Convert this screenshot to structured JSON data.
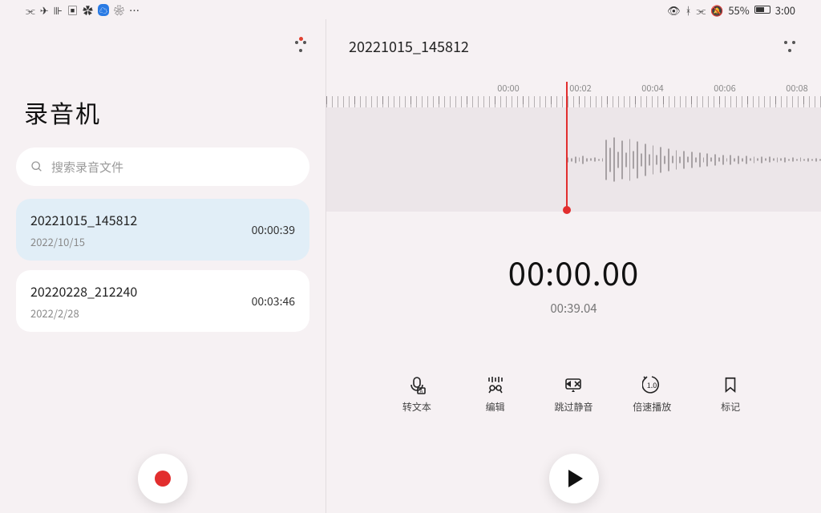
{
  "status": {
    "left_icons": [
      "wifi",
      "airplane",
      "sound",
      "video",
      "tv",
      "cloud",
      "wechat",
      "more"
    ],
    "battery_pct": "55%",
    "time": "3:00"
  },
  "app_title": "录音机",
  "search": {
    "placeholder": "搜索录音文件"
  },
  "recordings": [
    {
      "name": "20221015_145812",
      "date": "2022/10/15",
      "duration": "00:00:39",
      "selected": true
    },
    {
      "name": "20220228_212240",
      "date": "2022/2/28",
      "duration": "00:03:46",
      "selected": false
    }
  ],
  "player": {
    "title": "20221015_145812",
    "tick_labels": [
      "00:00",
      "00:02",
      "00:04",
      "00:06",
      "00:08"
    ],
    "current_time": "00:00.00",
    "total_time": "00:39.04"
  },
  "tools": {
    "transcribe": "转文本",
    "edit": "编辑",
    "skip_silence": "跳过静音",
    "speed": "倍速播放",
    "mark": "标记"
  }
}
